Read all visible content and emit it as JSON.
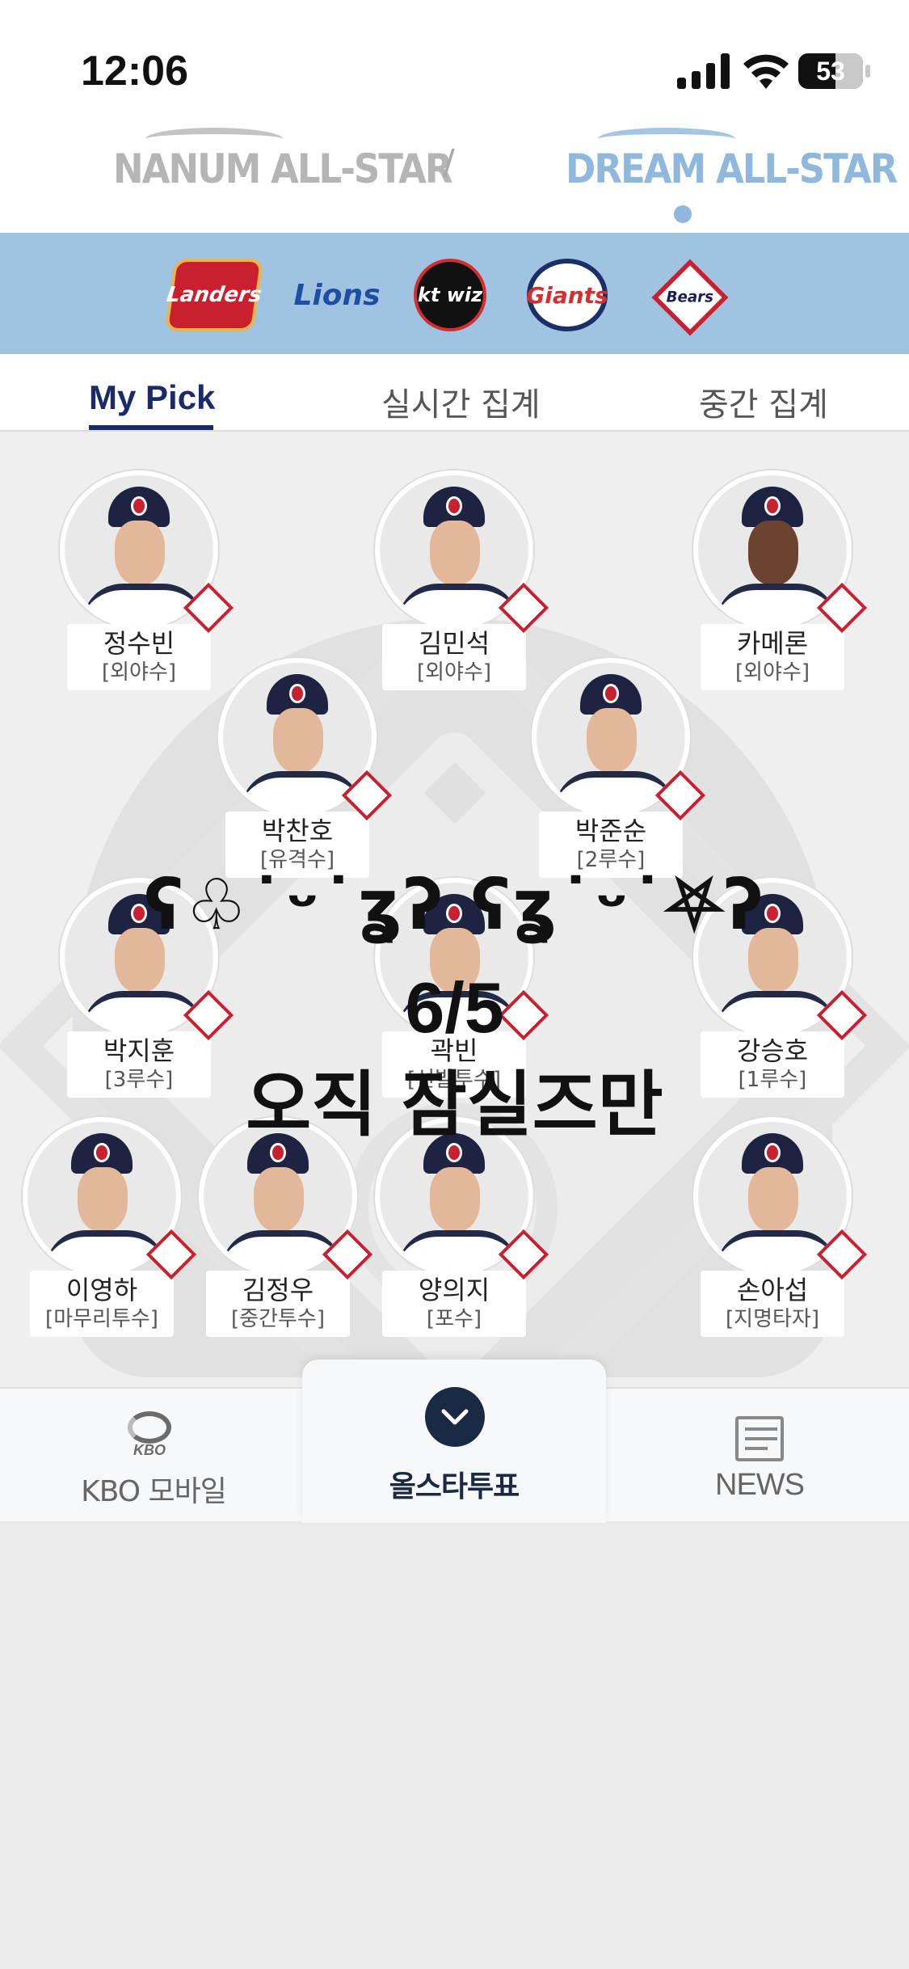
{
  "status_bar": {
    "time": "12:06",
    "battery": "53"
  },
  "header": {
    "left_brand": "NANUM ALL-STAR",
    "separator": "/",
    "right_brand": "DREAM ALL-STAR"
  },
  "teams": [
    {
      "name": "Landers",
      "icon": "landers-logo"
    },
    {
      "name": "Lions",
      "icon": "lions-logo"
    },
    {
      "name": "kt wiz",
      "icon": "ktwiz-logo"
    },
    {
      "name": "Giants",
      "icon": "giants-logo"
    },
    {
      "name": "Bears",
      "icon": "bears-logo"
    }
  ],
  "tabs": [
    {
      "label": "My Pick",
      "active": true
    },
    {
      "label": "실시간 집계",
      "active": false
    },
    {
      "label": "중간 집계",
      "active": false
    }
  ],
  "players": [
    {
      "name": "정수빈",
      "position": "[외야수]"
    },
    {
      "name": "김민석",
      "position": "[외야수]"
    },
    {
      "name": "카메론",
      "position": "[외야수]"
    },
    {
      "name": "박찬호",
      "position": "[유격수]"
    },
    {
      "name": "박준순",
      "position": "[2루수]"
    },
    {
      "name": "박지훈",
      "position": "[3루수]"
    },
    {
      "name": "곽빈",
      "position": "[선발투수]"
    },
    {
      "name": "강승호",
      "position": "[1루수]"
    },
    {
      "name": "이영하",
      "position": "[마무리투수]"
    },
    {
      "name": "김정우",
      "position": "[중간투수]"
    },
    {
      "name": "양의지",
      "position": "[포수]"
    },
    {
      "name": "손아섭",
      "position": "[지명타자]"
    }
  ],
  "overlay": {
    "kaomoji": "ʕ♧˙ᵕ˙ʓʔ ʕʓ˙ᵕ˙⛧ʔ",
    "date": "6/5",
    "slogan": "오직 잠실즈만"
  },
  "bottom_nav": {
    "kbo_small": "KBO",
    "kbo_label": "KBO 모바일",
    "allstar_label": "올스타투표",
    "news_label": "NEWS"
  },
  "colors": {
    "navy": "#1b2a6b",
    "team_strip": "#9fc3e0",
    "dream_blue": "#8fb8dc"
  }
}
